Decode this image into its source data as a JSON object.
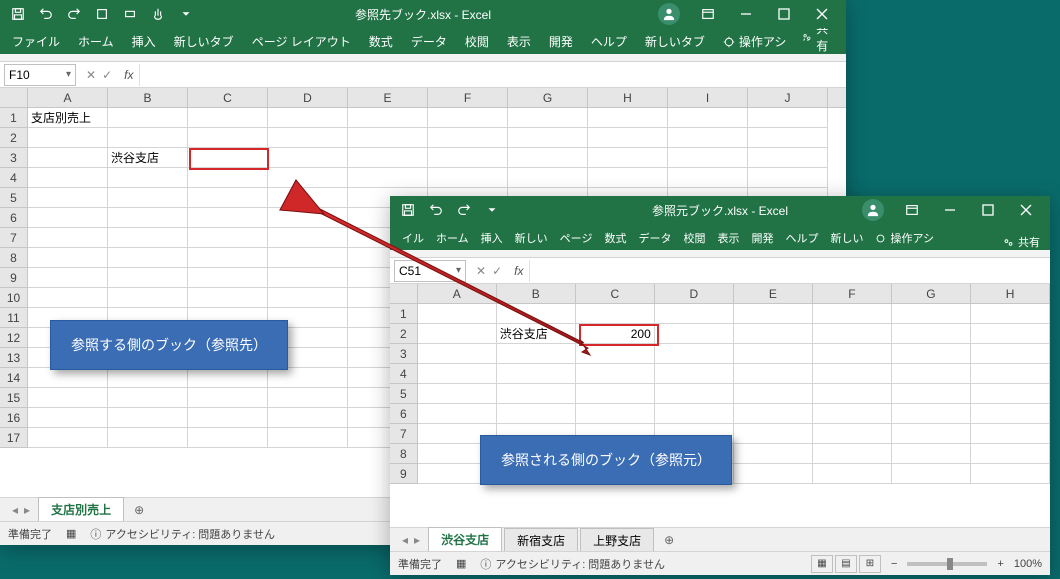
{
  "window1": {
    "title": "参照先ブック.xlsx - Excel",
    "tabs": {
      "file": "ファイル",
      "home": "ホーム",
      "insert": "挿入",
      "new1": "新しいタブ",
      "layout": "ページ レイアウト",
      "formula": "数式",
      "data": "データ",
      "review": "校閲",
      "view": "表示",
      "dev": "開発",
      "help": "ヘルプ",
      "new2": "新しいタブ",
      "tell": "操作アシ",
      "share": "共有"
    },
    "namebox": "F10",
    "columns": [
      "A",
      "B",
      "C",
      "D",
      "E",
      "F",
      "G",
      "H",
      "I",
      "J"
    ],
    "rows_count": 17,
    "cells": {
      "A1": "支店別売上",
      "B3": "渋谷支店"
    },
    "sheet_tabs": {
      "active": "支店別売上"
    },
    "status": {
      "ready": "準備完了",
      "access": "アクセシビリティ: 問題ありません"
    },
    "callout": "参照する側のブック（参照先）"
  },
  "window2": {
    "title": "参照元ブック.xlsx - Excel",
    "tabs": {
      "file": "イル",
      "home": "ホーム",
      "insert": "挿入",
      "new1": "新しい",
      "layout": "ページ",
      "formula": "数式",
      "data": "データ",
      "review": "校閲",
      "view": "表示",
      "dev": "開発",
      "help": "ヘルプ",
      "new2": "新しい",
      "tell": "操作アシ",
      "share": "共有"
    },
    "namebox": "C51",
    "columns": [
      "A",
      "B",
      "C",
      "D",
      "E",
      "F",
      "G",
      "H"
    ],
    "rows_count": 9,
    "cells": {
      "B2": "渋谷支店",
      "C2": "200"
    },
    "sheet_tabs": {
      "active": "渋谷支店",
      "others": [
        "新宿支店",
        "上野支店"
      ]
    },
    "status": {
      "ready": "準備完了",
      "access": "アクセシビリティ: 問題ありません",
      "zoom": "100%"
    },
    "callout": "参照される側のブック（参照元）"
  }
}
